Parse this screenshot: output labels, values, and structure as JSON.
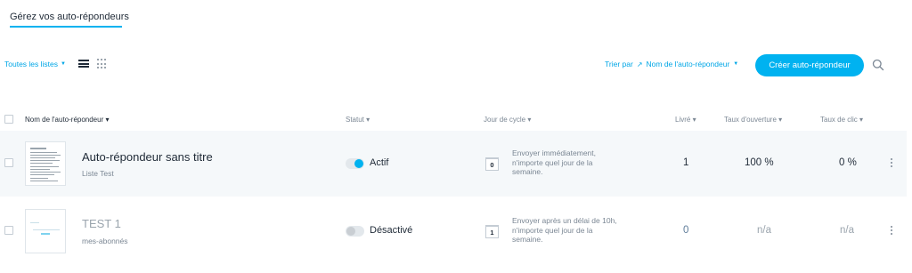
{
  "tab": {
    "title": "Gérez vos auto-répondeurs"
  },
  "toolbar": {
    "filter_label": "Toutes les listes",
    "sort_prefix": "Trier par",
    "sort_value": "Nom de l'auto-répondeur",
    "create_label": "Créer auto-répondeur",
    "accent_color": "#00b2f0"
  },
  "table": {
    "headers": {
      "name": "Nom de l'auto-répondeur",
      "status": "Statut",
      "cycle": "Jour de cycle",
      "delivered": "Livré",
      "open_rate": "Taux d'ouverture",
      "click_rate": "Taux de clic"
    },
    "rows": [
      {
        "title": "Auto-répondeur sans titre",
        "list": "Liste Test",
        "status": "Actif",
        "status_on": true,
        "cycle_day": "0",
        "cycle_text": "Envoyer immédiatement, n'importe quel jour de la semaine.",
        "delivered": "1",
        "open_rate": "100 %",
        "click_rate": "0 %"
      },
      {
        "title": "TEST 1",
        "list": "mes-abonnés",
        "status": "Désactivé",
        "status_on": false,
        "cycle_day": "1",
        "cycle_text": "Envoyer après un délai de 10h, n'importe quel jour de la semaine.",
        "delivered": "0",
        "open_rate": "n/a",
        "click_rate": "n/a"
      }
    ]
  }
}
